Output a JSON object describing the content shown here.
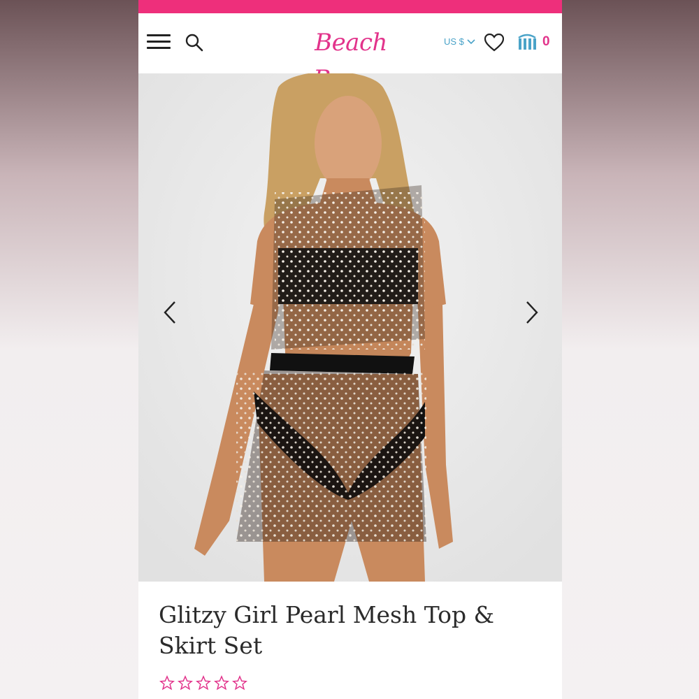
{
  "header": {
    "logo_text": "Beach Bunny",
    "currency": "US $",
    "cart_count": "0",
    "icons": {
      "menu": "hamburger-icon",
      "search": "search-icon",
      "currency_dropdown": "chevron-down-icon",
      "wishlist": "heart-icon",
      "cart": "shopping-bag-icon"
    }
  },
  "gallery": {
    "prev_icon": "chevron-left-icon",
    "next_icon": "chevron-right-icon"
  },
  "product": {
    "title": "Glitzy Girl Pearl Mesh Top & Skirt Set",
    "rating_stars": 0,
    "rating_max": 5
  },
  "colors": {
    "brand_pink": "#e2338b",
    "promo_bar": "#ee2f7b",
    "accent_blue": "#4aa3c8"
  }
}
